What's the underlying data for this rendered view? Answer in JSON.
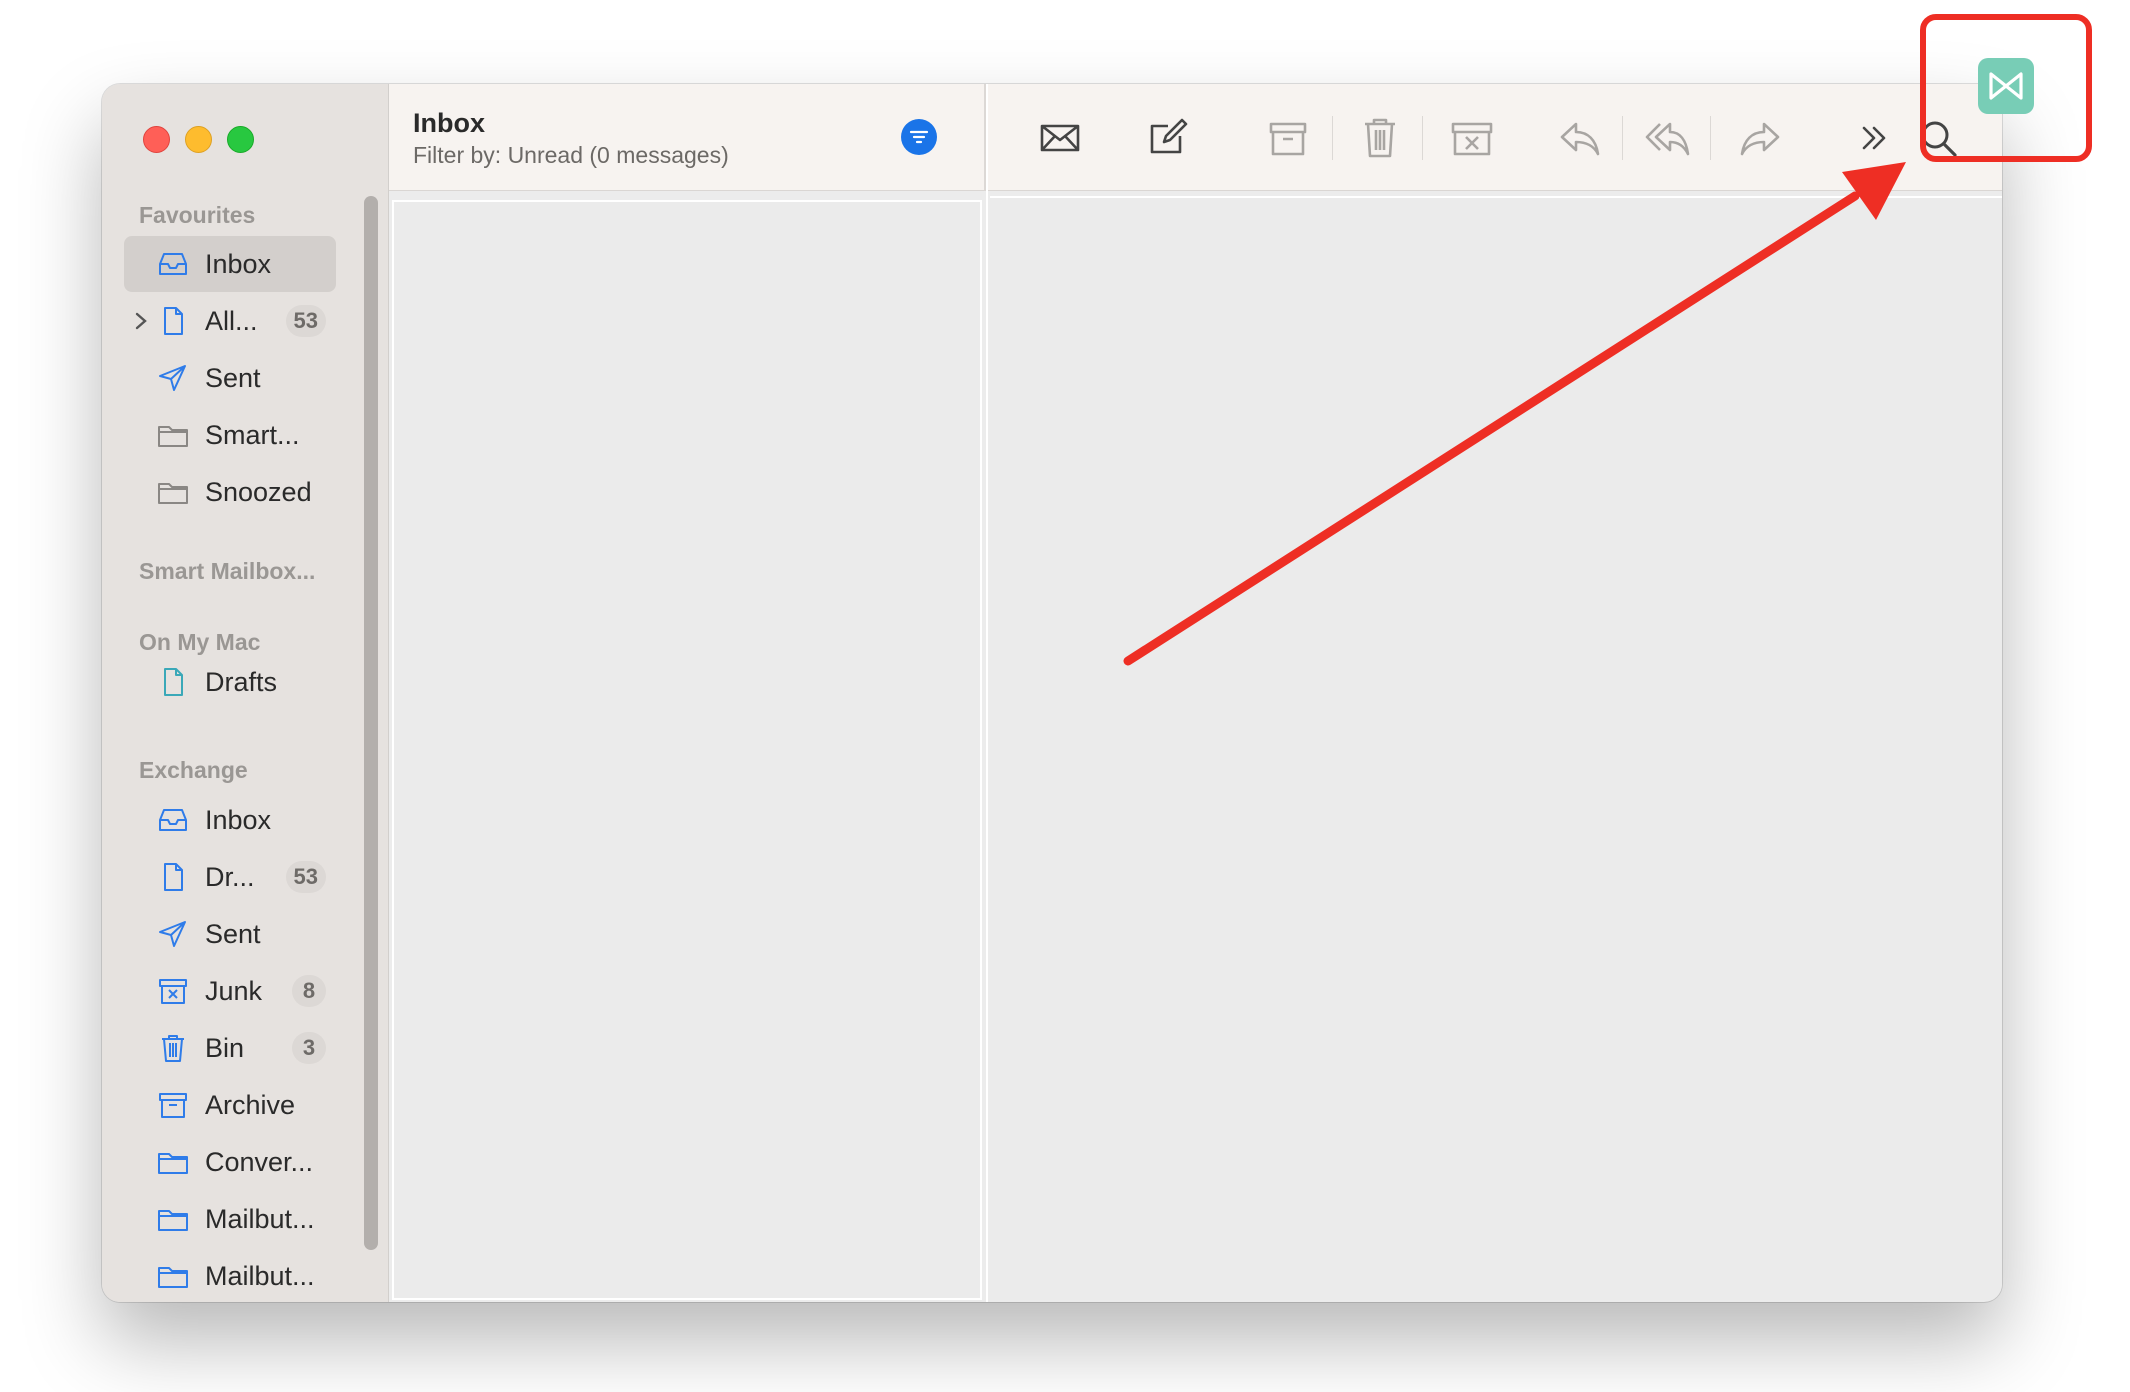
{
  "sidebar": {
    "sections": {
      "favourites": "Favourites",
      "smart_mailboxes": "Smart Mailbox...",
      "on_my_mac": "On My Mac",
      "exchange": "Exchange"
    },
    "favourites": [
      {
        "label": "Inbox",
        "icon": "inbox-icon",
        "selected": true
      },
      {
        "label": "All...",
        "icon": "document-icon",
        "badge": "53",
        "expandable": true
      },
      {
        "label": "Sent",
        "icon": "paperplane-icon"
      },
      {
        "label": "Smart...",
        "icon": "folder-icon"
      },
      {
        "label": "Snoozed",
        "icon": "folder-icon"
      }
    ],
    "on_my_mac": [
      {
        "label": "Drafts",
        "icon": "document-icon"
      }
    ],
    "exchange": [
      {
        "label": "Inbox",
        "icon": "inbox-icon"
      },
      {
        "label": "Dr...",
        "icon": "document-icon",
        "badge": "53"
      },
      {
        "label": "Sent",
        "icon": "paperplane-icon"
      },
      {
        "label": "Junk",
        "icon": "junk-icon",
        "badge": "8"
      },
      {
        "label": "Bin",
        "icon": "trash-icon",
        "badge": "3"
      },
      {
        "label": "Archive",
        "icon": "archive-icon"
      },
      {
        "label": "Conver...",
        "icon": "folder-icon"
      },
      {
        "label": "Mailbut...",
        "icon": "folder-icon"
      },
      {
        "label": "Mailbut...",
        "icon": "folder-icon"
      }
    ]
  },
  "message_list": {
    "title": "Inbox",
    "subtitle": "Filter by: Unread (0 messages)"
  },
  "toolbar": {
    "buttons": [
      "envelope-icon",
      "compose-icon",
      "archive-icon",
      "trash-icon",
      "junk-icon",
      "reply-icon",
      "reply-all-icon",
      "forward-icon",
      "more-icon",
      "search-icon"
    ]
  },
  "colors": {
    "accent": "#1a74e8",
    "annotation": "#ee2e24",
    "extension_icon": "#78cdb6"
  }
}
